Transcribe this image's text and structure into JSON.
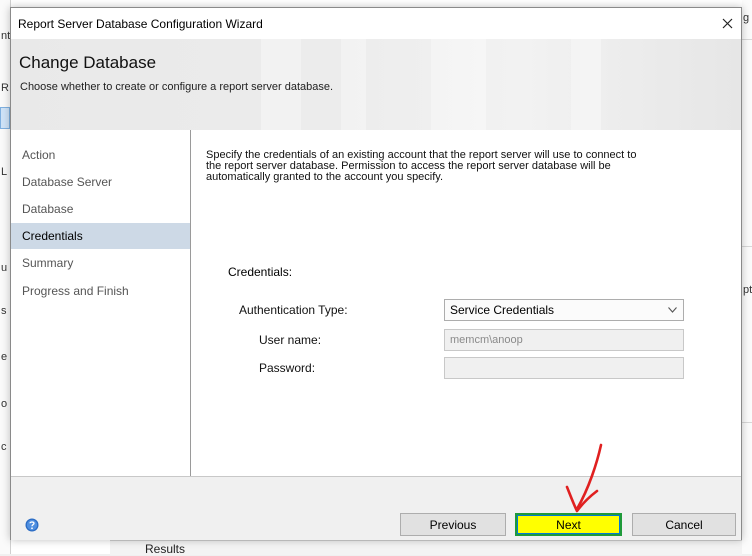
{
  "dialog": {
    "title": "Report Server Database Configuration Wizard",
    "close_glyph": "✕"
  },
  "banner": {
    "title": "Change Database",
    "subtitle": "Choose whether to create or configure a report server database."
  },
  "nav": {
    "items": [
      {
        "label": "Action"
      },
      {
        "label": "Database Server"
      },
      {
        "label": "Database"
      },
      {
        "label": "Credentials"
      },
      {
        "label": "Summary"
      },
      {
        "label": "Progress and Finish"
      }
    ],
    "active_index": 3
  },
  "content": {
    "description_lines": [
      "Specify the credentials of an existing account that the report server will use to connect to",
      "the report server database.  Permission to access the report server database will be",
      "automatically granted to the account you specify."
    ],
    "credentials_heading": "Credentials:",
    "auth_type_label": "Authentication Type:",
    "auth_type_value": "Service Credentials",
    "username_label": "User name:",
    "username_value": "memcm\\anoop",
    "password_label": "Password:",
    "password_value": ""
  },
  "footer": {
    "previous_label": "Previous",
    "next_label": "Next",
    "cancel_label": "Cancel"
  },
  "background": {
    "results_label": "Results",
    "left_fragments": [
      "nt",
      "R",
      "L",
      "u",
      "s",
      "e",
      "o",
      "c"
    ],
    "right_fragments": [
      "g",
      "pt"
    ]
  },
  "colors": {
    "next_highlight": "#ffff00",
    "next_border": "#1f9a3a",
    "annotation_arrow": "#e02020",
    "nav_active": "#cdd9e6",
    "help_icon": "#2b6cc4"
  },
  "icons": {
    "close": "close-icon",
    "dropdown": "chevron-down-icon",
    "help": "help-icon",
    "annotation": "red-arrow-annotation"
  }
}
